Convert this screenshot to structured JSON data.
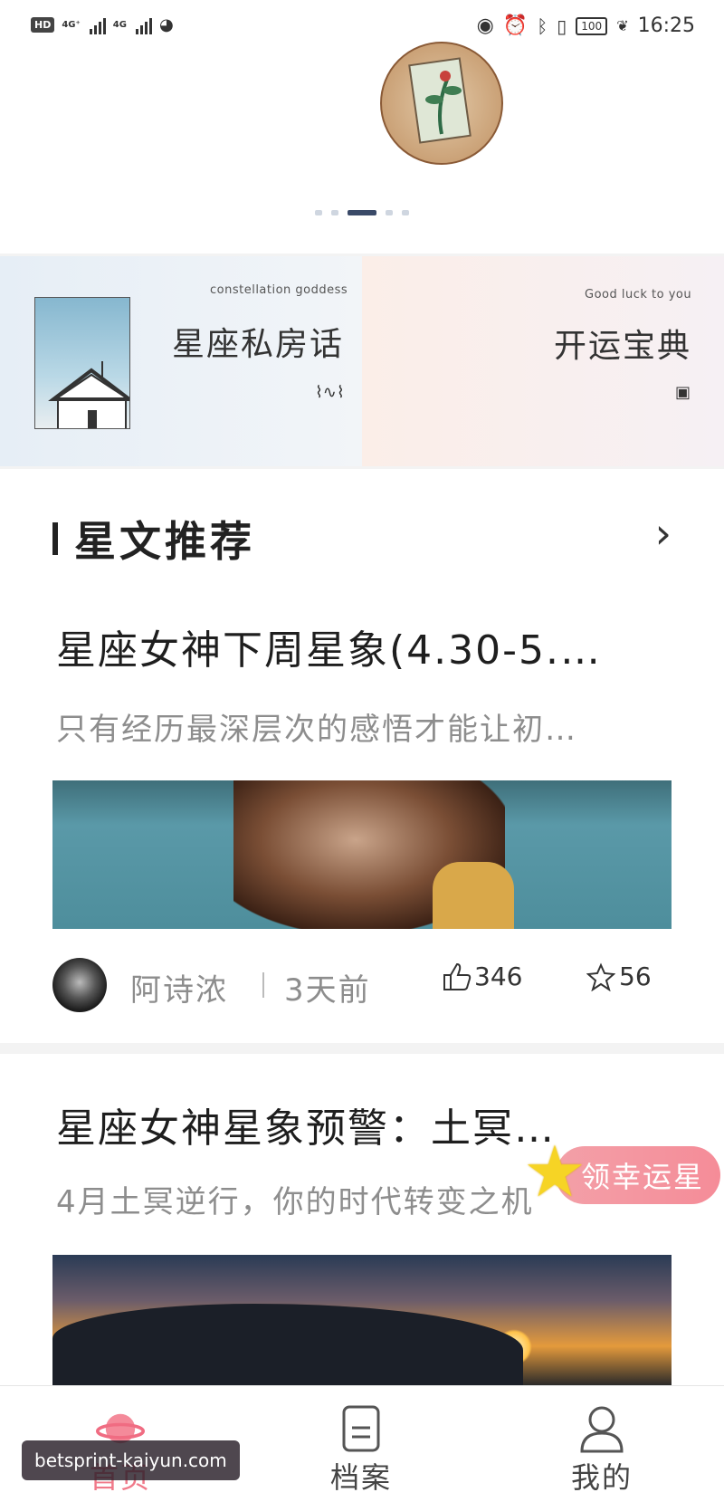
{
  "status_bar": {
    "hd": "HD",
    "net1": "4G⁺",
    "net2": "4G",
    "battery": "100",
    "time": "16:25"
  },
  "banner": {
    "page_count": 5,
    "active_index": 2
  },
  "cards": [
    {
      "subtitle": "constellation goddess",
      "title": "星座私房话",
      "icon": "pulse-icon"
    },
    {
      "subtitle": "Good luck to you",
      "title": "开运宝典",
      "icon": "screen-icon"
    }
  ],
  "section": {
    "title": "星文推荐",
    "more_icon": "chevron-right-icon"
  },
  "articles": [
    {
      "title": "星座女神下周星象(4.30-5.…",
      "desc": "只有经历最深层次的感悟才能让初…",
      "author": "阿诗浓",
      "time": "3天前",
      "likes": "346",
      "favorites": "56"
    },
    {
      "title": "星座女神星象预警：土冥…",
      "desc": "4月土冥逆行，你的时代转变之机"
    }
  ],
  "floating": {
    "label": "领幸运星"
  },
  "tabs": [
    {
      "label": "首页",
      "icon": "planet-icon",
      "active": true
    },
    {
      "label": "档案",
      "icon": "document-icon",
      "active": false
    },
    {
      "label": "我的",
      "icon": "user-icon",
      "active": false
    }
  ],
  "watermark": "betsprint-kaiyun.com",
  "colors": {
    "accent": "#f07a8a",
    "badge": "#f58c98",
    "star": "#f6d425"
  }
}
